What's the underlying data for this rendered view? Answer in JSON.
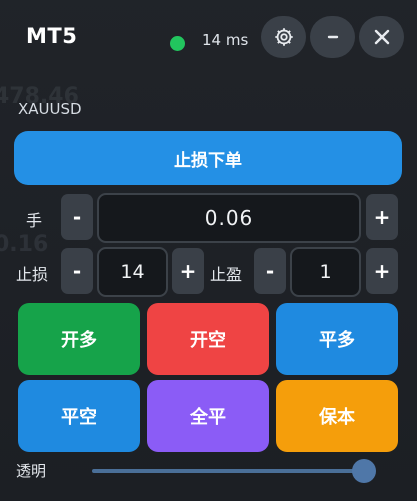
{
  "header": {
    "title": "MT5",
    "latency": "14 ms",
    "status_color": "#22c55e"
  },
  "symbol": "XAUUSD",
  "stop_order_label": "止损下单",
  "lot": {
    "label": "手",
    "value": "0.06",
    "minus": "-",
    "plus": "+"
  },
  "stop_loss": {
    "label": "止损",
    "value": "14",
    "minus": "-",
    "plus": "+"
  },
  "take_profit": {
    "label": "止盈",
    "value": "1",
    "minus": "-",
    "plus": "+"
  },
  "actions": [
    {
      "label": "开多",
      "color": "#16a34a"
    },
    {
      "label": "开空",
      "color": "#ef4444"
    },
    {
      "label": "平多",
      "color": "#1f8ae0"
    },
    {
      "label": "平空",
      "color": "#1f8ae0"
    },
    {
      "label": "全平",
      "color": "#8b5cf6"
    },
    {
      "label": "保本",
      "color": "#f59e0b"
    }
  ],
  "opacity": {
    "label": "透明",
    "value": 0.97
  },
  "icons": {
    "settings": "gear-icon",
    "minimize": "minimize-icon",
    "close": "close-icon"
  }
}
